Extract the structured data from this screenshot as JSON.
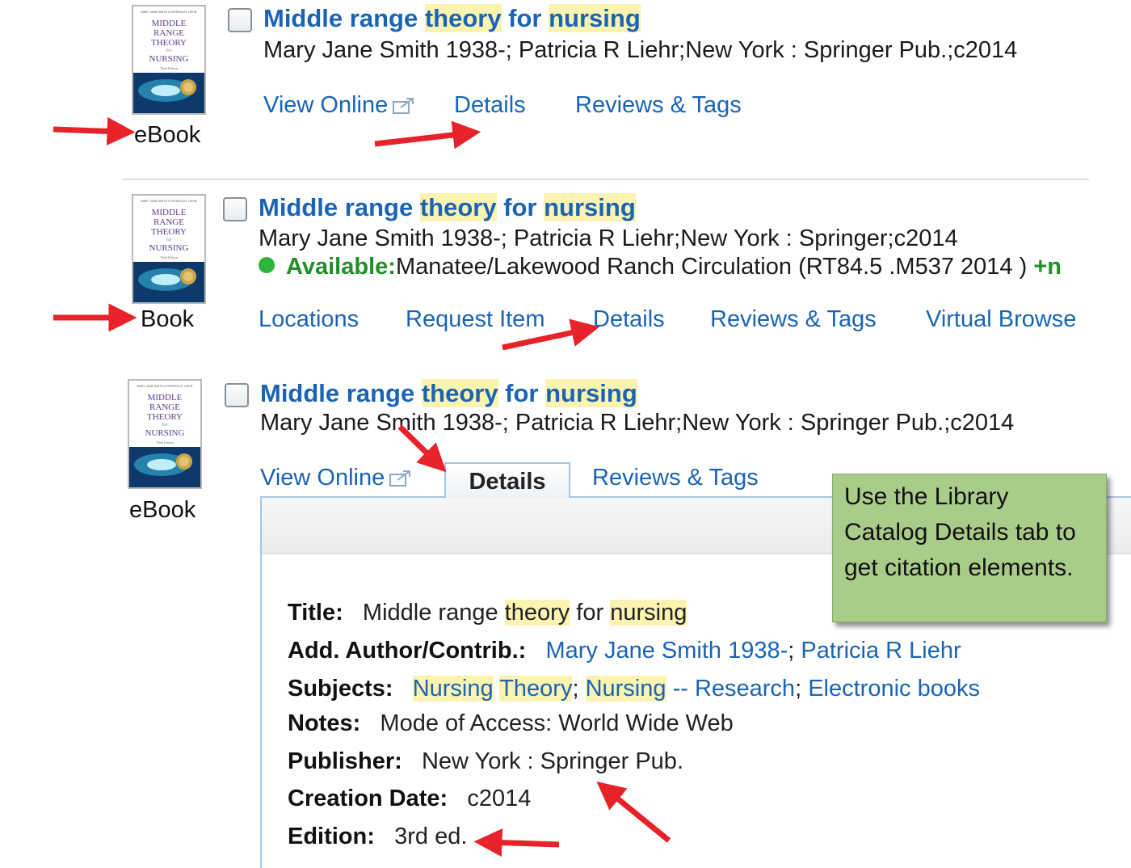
{
  "results": [
    {
      "format": "eBook",
      "title_parts": [
        {
          "text": "Middle range ",
          "hl": false
        },
        {
          "text": "theory",
          "hl": true
        },
        {
          "text": " for ",
          "hl": false
        },
        {
          "text": "nursing",
          "hl": true
        }
      ],
      "meta": "Mary Jane Smith 1938-; Patricia R Liehr;New York : Springer Pub.;c2014",
      "links": [
        "View Online",
        "Details",
        "Reviews & Tags"
      ]
    },
    {
      "format": "Book",
      "title_parts": [
        {
          "text": "Middle range ",
          "hl": false
        },
        {
          "text": "theory",
          "hl": true
        },
        {
          "text": " for ",
          "hl": false
        },
        {
          "text": "nursing",
          "hl": true
        }
      ],
      "meta": "Mary Jane Smith 1938-; Patricia R Liehr;New York : Springer;c2014",
      "availability": {
        "status": "Available:",
        "location": "Manatee/Lakewood Ranch Circulation (RT84.5 .M537 2014 )",
        "more": "+n",
        "color": "#2bb63a"
      },
      "links": [
        "Locations",
        "Request Item",
        "Details",
        "Reviews & Tags",
        "Virtual Browse"
      ]
    },
    {
      "format": "eBook",
      "title_parts": [
        {
          "text": "Middle range ",
          "hl": false
        },
        {
          "text": "theory",
          "hl": true
        },
        {
          "text": " for ",
          "hl": false
        },
        {
          "text": "nursing",
          "hl": true
        }
      ],
      "meta": "Mary Jane Smith 1938-; Patricia R Liehr;New York : Springer Pub.;c2014",
      "links": [
        "View Online",
        "Details",
        "Reviews & Tags"
      ]
    }
  ],
  "cover": {
    "top_text": "MARY JANE SMITH & PATRICIA R. LIEHR",
    "lines": [
      "MIDDLE",
      "RANGE",
      "THEORY",
      "for",
      "NURSING"
    ],
    "edition": "Third Edition"
  },
  "details": {
    "title_label": "Title:",
    "title_parts": [
      {
        "text": "Middle range ",
        "hl": false
      },
      {
        "text": "theory",
        "hl": true
      },
      {
        "text": " for ",
        "hl": false
      },
      {
        "text": "nursing",
        "hl": true
      }
    ],
    "author_label": "Add. Author/Contrib.:",
    "authors": [
      "Mary Jane Smith 1938-",
      "Patricia R Liehr"
    ],
    "subjects_label": "Subjects:",
    "subjects": [
      {
        "text": "Nursing",
        "hl": true,
        "link": true
      },
      {
        "text": " ",
        "hl": false,
        "link": false
      },
      {
        "text": "Theory",
        "hl": true,
        "link": true
      },
      {
        "text": "; ",
        "hl": false,
        "link": false
      },
      {
        "text": "Nursing",
        "hl": true,
        "link": true
      },
      {
        "text": " -- Research",
        "hl": false,
        "link": true
      },
      {
        "text": "; ",
        "hl": false,
        "link": false
      },
      {
        "text": "Electronic books",
        "hl": false,
        "link": true
      }
    ],
    "notes_label": "Notes:",
    "notes": "Mode of Access: World Wide Web",
    "publisher_label": "Publisher:",
    "publisher": "New York : Springer Pub.",
    "creation_label": "Creation Date:",
    "creation": "c2014",
    "edition_label": "Edition:",
    "edition": "3rd ed."
  },
  "callout": "Use the Library Catalog Details tab to get citation elements.",
  "colors": {
    "link": "#1a64b5",
    "highlight": "#fbf3b0",
    "available": "#208f2a",
    "callout": "#a9cc8b",
    "arrow": "#e8222a"
  }
}
